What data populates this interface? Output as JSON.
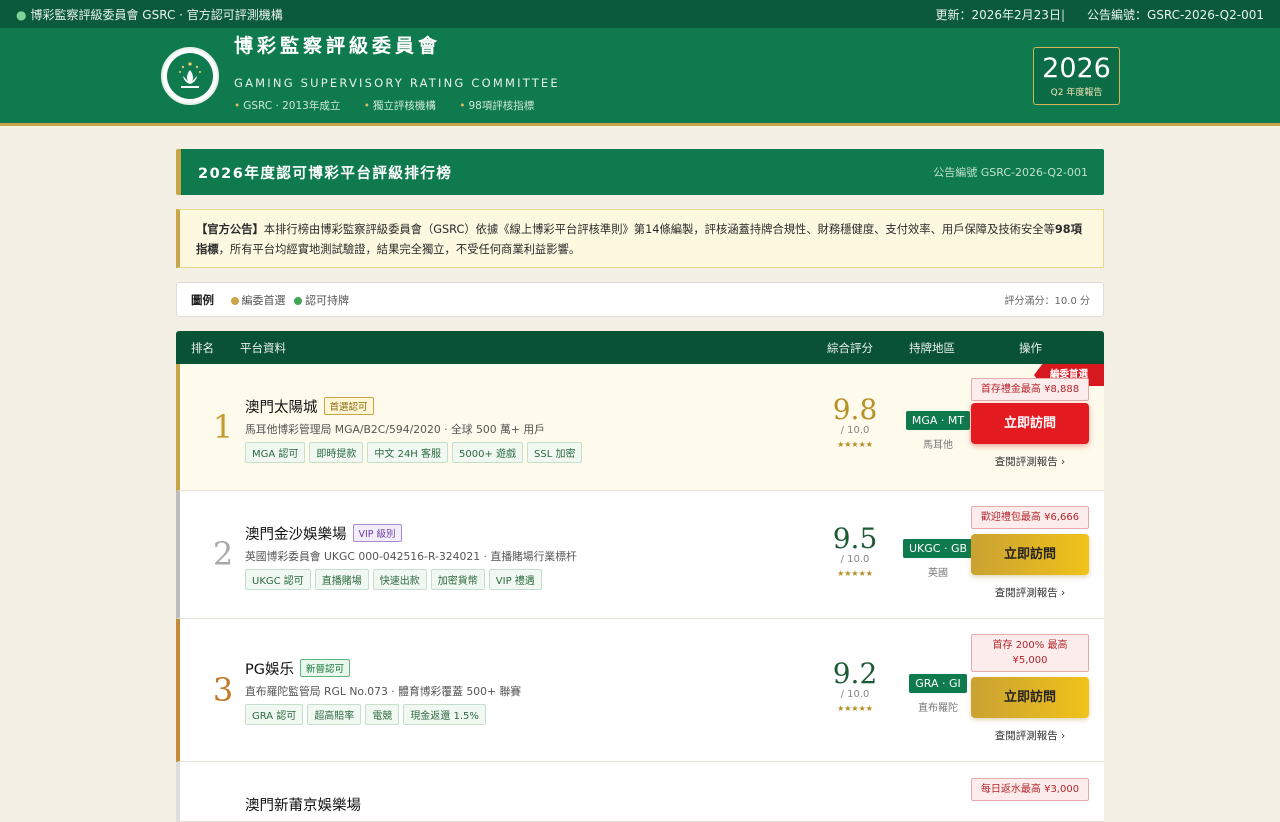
{
  "topbar": {
    "left": "博彩監察評級委員會 GSRC · 官方認可評測機構",
    "update": "更新：2026年2月23日",
    "separator": "|",
    "notice_no": "公告編號：GSRC-2026-Q2-001"
  },
  "header": {
    "title_cn": "博彩監察評級委員會",
    "title_en": "GAMING SUPERVISORY RATING COMMITTEE",
    "meta": [
      "GSRC · 2013年成立",
      "獨立評核機構",
      "98項評核指標"
    ],
    "year": "2026",
    "year_sub": "Q2 年度報告"
  },
  "section": {
    "title": "2026年度認可博彩平台評級排行榜",
    "code": "公告編號 GSRC-2026-Q2-001"
  },
  "notice": {
    "label": "【官方公告】",
    "text": "本排行榜由博彩監察評級委員會（GSRC）依據《線上博彩平台評核準則》第14條編製，評核涵蓋持牌合規性、財務穩健度、支付效率、用戶保障及技術安全等",
    "bold": "98項指標",
    "tail": "，所有平台均經實地測試驗證，結果完全獨立，不受任何商業利益影響。"
  },
  "legend": {
    "label": "圖例",
    "items": [
      "編委首選",
      "認可持牌"
    ],
    "right": "評分滿分：10.0 分"
  },
  "table": {
    "headers": [
      "排名",
      "平台資料",
      "綜合評分",
      "持牌地區",
      "操作"
    ],
    "rows": [
      {
        "rank": "1",
        "name": "澳門太陽城",
        "badge": "首選認可",
        "desc": "馬耳他博彩管理局 MGA/B2C/594/2020 · 全球 500 萬+ 用戶",
        "tags": [
          "MGA 認可",
          "即時提款",
          "中文 24H 客服",
          "5000+ 遊戲",
          "SSL 加密"
        ],
        "score": "9.8",
        "out_of": "/ 10.0",
        "stars": "★★★★★",
        "license": "MGA · MT",
        "country": "馬耳他",
        "bonus": "首存禮金最高 ¥8,888",
        "visit": "立即訪問",
        "report": "查閱評測報告 ›",
        "ribbon": "編委首選"
      },
      {
        "rank": "2",
        "name": "澳門金沙娛樂場",
        "badge": "VIP 級別",
        "desc": "英國博彩委員會 UKGC 000-042516-R-324021 · 直播賭場行業標杆",
        "tags": [
          "UKGC 認可",
          "直播賭場",
          "快速出款",
          "加密貨幣",
          "VIP 禮遇"
        ],
        "score": "9.5",
        "out_of": "/ 10.0",
        "stars": "★★★★★",
        "license": "UKGC · GB",
        "country": "英國",
        "bonus": "歡迎禮包最高 ¥6,666",
        "visit": "立即訪問",
        "report": "查閱評測報告 ›"
      },
      {
        "rank": "3",
        "name": "PG娛乐",
        "badge": "新晉認可",
        "desc": "直布羅陀監管局 RGL No.073 · 體育博彩覆蓋 500+ 聯賽",
        "tags": [
          "GRA 認可",
          "超高賠率",
          "電競",
          "現金返還 1.5%"
        ],
        "score": "9.2",
        "out_of": "/ 10.0",
        "stars": "★★★★★",
        "license": "GRA · GI",
        "country": "直布羅陀",
        "bonus": "首存 200% 最高 ¥5,000",
        "visit": "立即訪問",
        "report": "查閱評測報告 ›"
      },
      {
        "rank": "",
        "name": "澳門新莆京娛樂場",
        "bonus": "每日返水最高 ¥3,000"
      }
    ]
  },
  "colors": {
    "primary_green": "#0e7a4e",
    "dark_green": "#0a5236",
    "gold": "#c9a54a",
    "cta_red": "#e31a1f"
  }
}
